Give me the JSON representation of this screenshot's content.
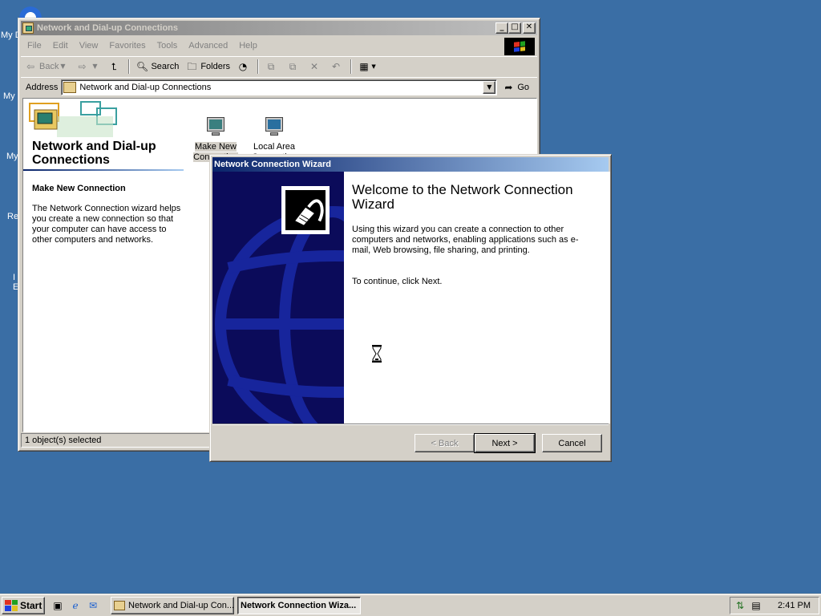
{
  "desktop": {
    "icon_labels": [
      "My D",
      "My",
      "My",
      "Re",
      "I",
      "E"
    ]
  },
  "explorer": {
    "title": "Network and Dial-up Connections",
    "title_buttons": {
      "minimize": "_",
      "maximize": "□",
      "close": "✕"
    },
    "menu": [
      "File",
      "Edit",
      "View",
      "Favorites",
      "Tools",
      "Advanced",
      "Help"
    ],
    "toolbar": {
      "back": "Back",
      "search": "Search",
      "folders": "Folders"
    },
    "address": {
      "label": "Address",
      "value": "Network and Dial-up Connections",
      "go": "Go"
    },
    "left_pane": {
      "title": "Network and Dial-up Connections",
      "subtitle": "Make New Connection",
      "description": "The Network Connection wizard helps you create a new connection so that your computer can have access to other computers and networks."
    },
    "items": [
      {
        "label": "Make New Connection",
        "icon": "make-new-connection-icon",
        "selected": true
      },
      {
        "label": "Local Area Connection",
        "icon": "local-area-connection-icon",
        "selected": false
      }
    ],
    "status": "1 object(s) selected"
  },
  "wizard": {
    "title": "Network Connection Wizard",
    "heading": "Welcome to the Network Connection Wizard",
    "text": "Using this wizard you can create a connection to other computers and networks, enabling applications such as e-mail, Web browsing, file sharing, and printing.",
    "continue_text": "To continue, click Next.",
    "buttons": {
      "back": "< Back",
      "next": "Next >",
      "cancel": "Cancel"
    },
    "colors": {
      "side_panel": "#0b0b5a",
      "globe": "#1a2aa8"
    }
  },
  "taskbar": {
    "start": "Start",
    "tasks": [
      {
        "label": "Network and Dial-up Con...",
        "active": false
      },
      {
        "label": "Network Connection Wiza...",
        "active": true
      }
    ],
    "clock": "2:41 PM"
  },
  "colors": {
    "desktop": "#3a6ea5",
    "active_title_start": "#0a246a",
    "active_title_end": "#a6caf0",
    "inactive_title_start": "#808080",
    "inactive_title_end": "#c0c0c0",
    "face": "#d4d0c8"
  }
}
